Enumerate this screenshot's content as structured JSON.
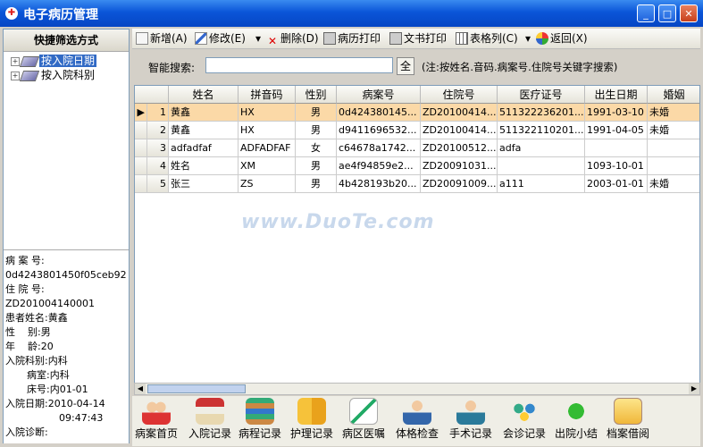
{
  "window": {
    "title": "电子病历管理",
    "controls": [
      "_",
      "□",
      "✕"
    ]
  },
  "left": {
    "header": "快捷筛选方式",
    "tree": [
      {
        "label": "按入院日期",
        "selected": true
      },
      {
        "label": "按入院科别",
        "selected": false
      }
    ],
    "info": {
      "case_no_label": "病 案 号:",
      "case_no": "0d4243801450f05ceb92",
      "inpatient_no_label": "住 院 号:",
      "inpatient_no": "ZD201004140001",
      "name_label": "患者姓名:",
      "name": "黄鑫",
      "gender_label": "性    别:",
      "gender": "男",
      "age_label": "年    龄:",
      "age": "20",
      "dept_label": "入院科别:",
      "dept": "内科",
      "ward_label": "病室:",
      "ward": "内科",
      "bed_label": "床号:",
      "bed": "内01-01",
      "admit_date_label": "入院日期:",
      "admit_date": "2010-04-14",
      "admit_time": "09:47:43",
      "diagnosis_label": "入院诊断:"
    }
  },
  "toolbar": {
    "add": "新增(A)",
    "edit": "修改(E)",
    "delete": "删除(D)",
    "print_record": "病历打印",
    "print_doc": "文书打印",
    "columns": "表格列(C)",
    "back": "返回(X)",
    "edit_dropdown": "▾",
    "columns_dropdown": "▾"
  },
  "search": {
    "label": "智能搜索:",
    "value": "",
    "all_button": "全",
    "note": "(注:按姓名.音码.病案号.住院号关键字搜索)"
  },
  "grid": {
    "columns": [
      "",
      "姓名",
      "拼音码",
      "性别",
      "病案号",
      "住院号",
      "医疗证号",
      "出生日期",
      "婚姻"
    ],
    "rows": [
      {
        "marker": "▶",
        "idx": "1",
        "name": "黄鑫",
        "pinyin": "HX",
        "gender": "男",
        "case_no": "0d424380145...",
        "inpatient_no": "ZD20100414...",
        "medical_no": "511322236201...",
        "birth": "1991-03-10",
        "marriage": "未婚",
        "selected": true
      },
      {
        "marker": "",
        "idx": "2",
        "name": "黄鑫",
        "pinyin": "HX",
        "gender": "男",
        "case_no": "d9411696532...",
        "inpatient_no": "ZD20100414...",
        "medical_no": "511322110201...",
        "birth": "1991-04-05",
        "marriage": "未婚",
        "selected": false
      },
      {
        "marker": "",
        "idx": "3",
        "name": "adfadfaf",
        "pinyin": "ADFADFAF",
        "gender": "女",
        "case_no": "c64678a1742...",
        "inpatient_no": "ZD20100512...",
        "medical_no": "adfa",
        "birth": "",
        "marriage": "",
        "selected": false
      },
      {
        "marker": "",
        "idx": "4",
        "name": "姓名",
        "pinyin": "XM",
        "gender": "男",
        "case_no": "ae4f94859e2...",
        "inpatient_no": "ZD20091031...",
        "medical_no": "",
        "birth": "1093-10-01",
        "marriage": "",
        "selected": false
      },
      {
        "marker": "",
        "idx": "5",
        "name": "张三",
        "pinyin": "ZS",
        "gender": "男",
        "case_no": "4b428193b20...",
        "inpatient_no": "ZD20091009...",
        "medical_no": "a111",
        "birth": "2003-01-01",
        "marriage": "未婚",
        "selected": false
      }
    ]
  },
  "bottom": [
    "病案首页",
    "入院记录",
    "病程记录",
    "护理记录",
    "病区医嘱",
    "体格检查",
    "手术记录",
    "会诊记录",
    "出院小结",
    "档案借阅"
  ],
  "watermark": "www.DuoTe.com",
  "colors": {
    "title_bar": "#0a55d8",
    "selected_row": "#fbd9a7",
    "tree_selected": "#316ac5"
  }
}
